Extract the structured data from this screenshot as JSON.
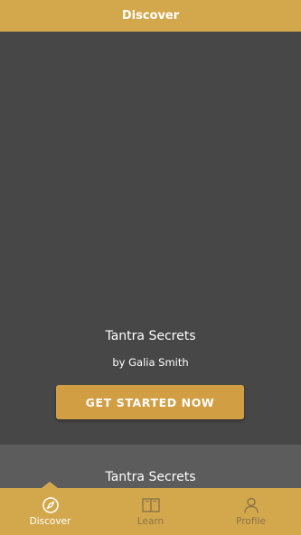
{
  "header": {
    "title": "Discover"
  },
  "hero": {
    "title": "Tantra Secrets",
    "author": "by Galia Smith",
    "cta_label": "GET STARTED NOW"
  },
  "next_card": {
    "title": "Tantra Secrets"
  },
  "tabbar": {
    "tabs": [
      {
        "label": "Discover",
        "icon": "compass-icon",
        "active": true
      },
      {
        "label": "Learn",
        "icon": "book-icon",
        "active": false
      },
      {
        "label": "Profile",
        "icon": "person-icon",
        "active": false
      }
    ]
  },
  "colors": {
    "accent": "#d3a84d",
    "button": "#d19e43",
    "background": "#474747",
    "inactive_tab": "#8c7348"
  }
}
